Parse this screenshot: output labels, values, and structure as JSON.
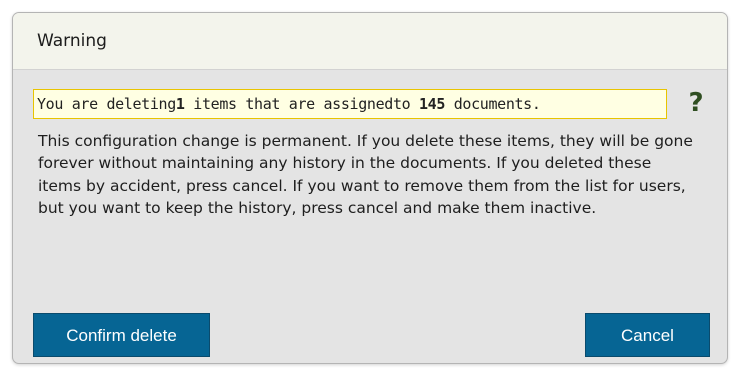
{
  "dialog": {
    "title": "Warning",
    "summary": {
      "prefix": "You are deleting",
      "item_count": "1",
      "middle": "items that are assignedto",
      "document_count": "145",
      "suffix": "documents."
    },
    "help_icon": "?",
    "message": "This configuration change is permanent. If you delete these items, they will be gone forever without maintaining any history in the documents. If you deleted these items by accident, press cancel. If you want to remove them from the list for users, but you want to keep the history, press cancel and make them inactive.",
    "buttons": {
      "confirm_label": "Confirm delete",
      "cancel_label": "Cancel"
    }
  },
  "colors": {
    "title_background": "#f3f4ec",
    "dialog_background": "#e4e4e4",
    "summary_background": "#ffffe3",
    "summary_border": "#e8c400",
    "help_icon": "#2f4e21",
    "button_background": "#066594",
    "button_text": "#ffffff"
  },
  "icons": {
    "help": "question-mark-icon"
  }
}
